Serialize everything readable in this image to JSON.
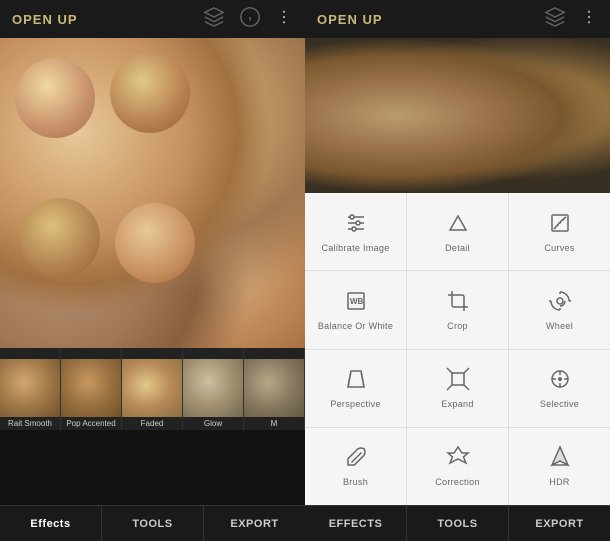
{
  "app": {
    "title": "OPEN UP"
  },
  "left_panel": {
    "header": {
      "title": "OPEN UP",
      "icons": [
        "layers-icon",
        "info-icon",
        "more-icon"
      ]
    },
    "thumbnails": [
      {
        "label": "Rait Smooth"
      },
      {
        "label": "Pop Accented"
      },
      {
        "label": "Faded"
      },
      {
        "label": "Glow"
      },
      {
        "label": "M"
      }
    ],
    "bottom_tabs": [
      {
        "label": "Effects",
        "active": true
      },
      {
        "label": "TOOLS"
      },
      {
        "label": "EXPORT"
      }
    ]
  },
  "right_panel": {
    "header": {
      "title": "OPEN UP",
      "icons": [
        "layers-icon",
        "more-icon"
      ]
    },
    "tools": [
      {
        "label": "Calibrate Image",
        "icon": "sliders"
      },
      {
        "label": "Detail",
        "icon": "triangle"
      },
      {
        "label": "Curves",
        "icon": "curve"
      },
      {
        "label": "Balance Or White",
        "icon": "wb"
      },
      {
        "label": "Crop",
        "icon": "crop"
      },
      {
        "label": "Wheel",
        "icon": "wheel"
      },
      {
        "label": "Perspective",
        "icon": "perspective"
      },
      {
        "label": "Expand",
        "icon": "expand"
      },
      {
        "label": "Selective",
        "icon": "selective"
      },
      {
        "label": "Brush",
        "icon": "brush"
      },
      {
        "label": "Correction",
        "icon": "correction"
      },
      {
        "label": "HDR",
        "icon": "hdr"
      }
    ],
    "bottom_tabs": [
      {
        "label": "EFFECTS"
      },
      {
        "label": "TOOLS"
      },
      {
        "label": "EXPORT"
      }
    ]
  }
}
